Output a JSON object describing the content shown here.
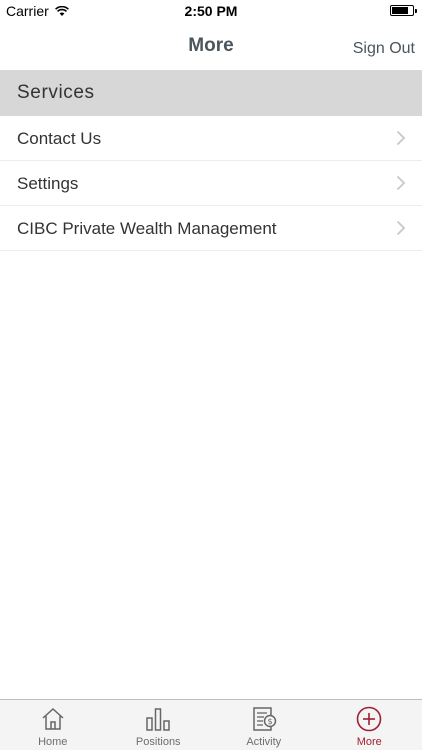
{
  "status_bar": {
    "carrier": "Carrier",
    "time": "2:50 PM",
    "battery_level": 0.8
  },
  "nav": {
    "title": "More",
    "sign_out": "Sign Out"
  },
  "section": {
    "title": "Services"
  },
  "items": [
    {
      "label": "Contact Us"
    },
    {
      "label": "Settings"
    },
    {
      "label": "CIBC Private Wealth Management"
    }
  ],
  "tabs": [
    {
      "label": "Home",
      "icon": "home-icon"
    },
    {
      "label": "Positions",
      "icon": "bar-chart-icon"
    },
    {
      "label": "Activity",
      "icon": "document-dollar-icon"
    },
    {
      "label": "More",
      "icon": "plus-circle-icon",
      "active": true
    }
  ],
  "colors": {
    "accent": "#a11e32",
    "nav_text": "#4b555c",
    "section_bg": "#d7d7d7"
  }
}
